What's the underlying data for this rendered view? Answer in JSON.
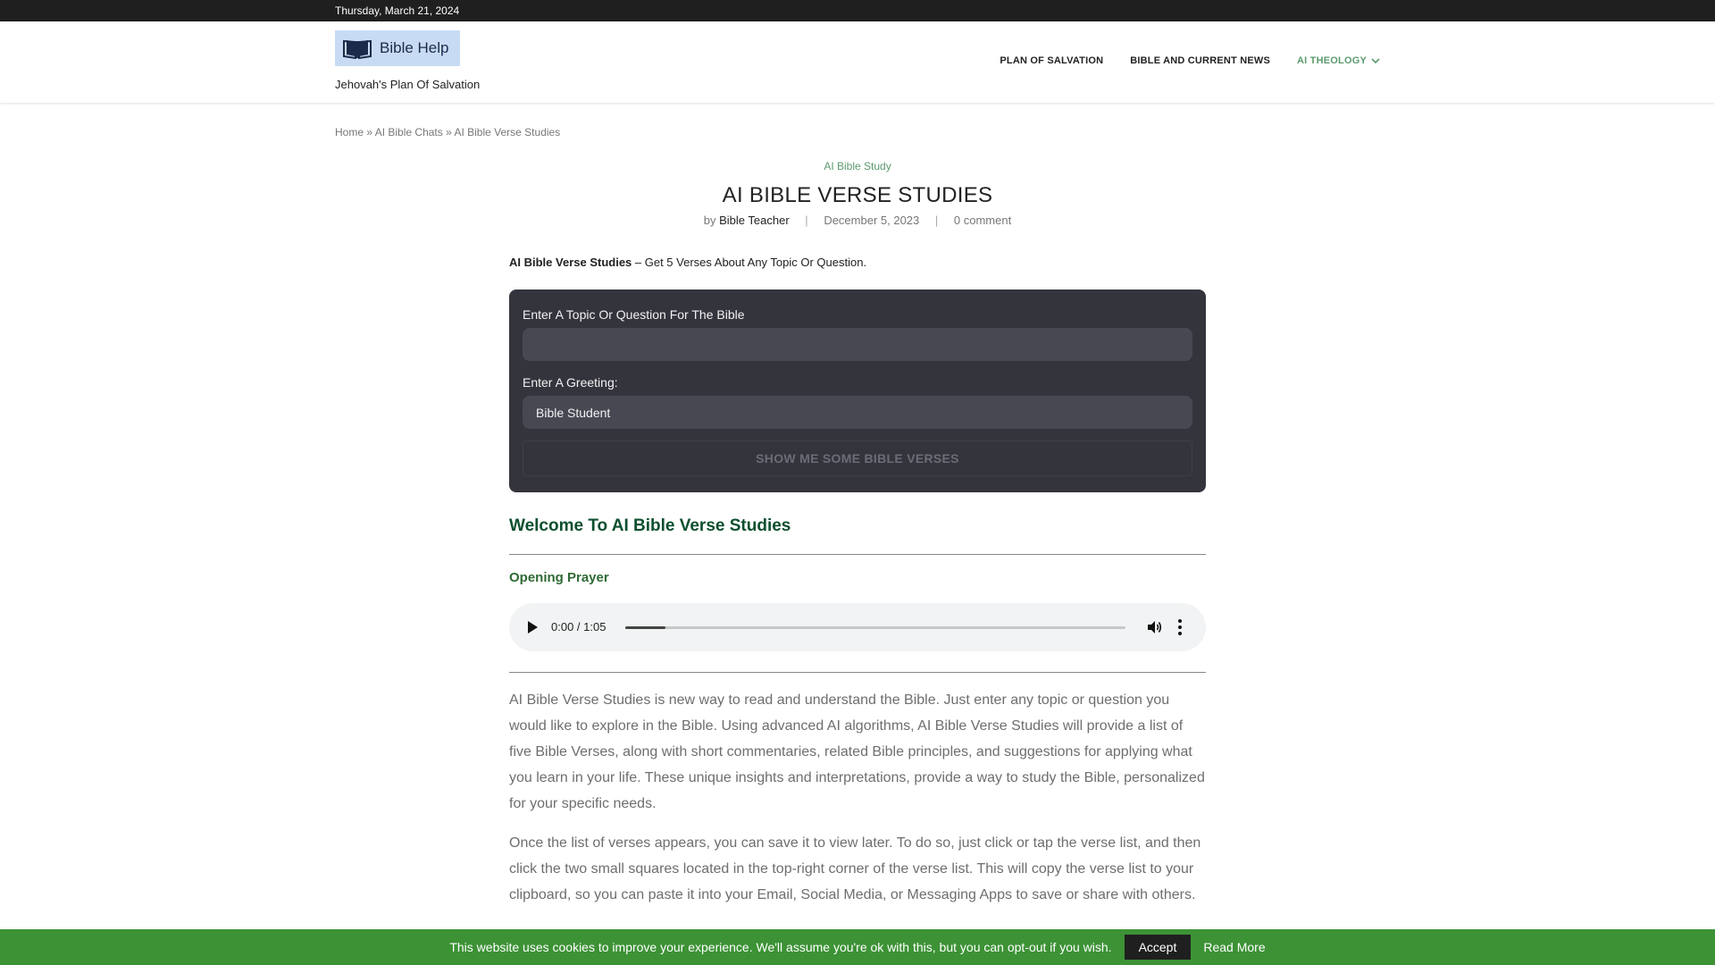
{
  "topbar": {
    "date": "Thursday, March 21, 2024"
  },
  "header": {
    "logo_text": "Bible Help",
    "tagline": "Jehovah's Plan Of Salvation",
    "nav": [
      {
        "label": "PLAN OF SALVATION"
      },
      {
        "label": "BIBLE AND CURRENT NEWS"
      },
      {
        "label": "AI THEOLOGY"
      }
    ]
  },
  "breadcrumb": {
    "home": "Home",
    "sep1": "»",
    "chats": "AI Bible Chats",
    "sep2": "»",
    "current": "AI Bible Verse Studies"
  },
  "post": {
    "category": "AI Bible Study",
    "title": "AI BIBLE VERSE STUDIES",
    "by": "by",
    "author": "Bible Teacher",
    "sep": "|",
    "date": "December 5, 2023",
    "comments": "0 comment",
    "intro_bold": "AI Bible Verse Studies",
    "intro_rest": " – Get 5 Verses About Any Topic Or Question."
  },
  "form": {
    "topic_label": "Enter A Topic Or Question For The Bible",
    "topic_value": "",
    "greeting_label": "Enter A Greeting:",
    "greeting_value": "Bible Student",
    "submit_label": "SHOW ME SOME BIBLE VERSES"
  },
  "welcome": "Welcome To AI Bible Verse Studies",
  "prayer": {
    "heading": "Opening Prayer",
    "time": "0:00 / 1:05",
    "progress": 0.08
  },
  "paragraphs": [
    "AI Bible Verse Studies is new way to read and understand the Bible. Just enter any topic or question you would like to explore in the Bible. Using advanced AI algorithms, AI Bible Verse Studies will provide a list of five Bible Verses, along with short commentaries, related Bible principles, and suggestions for applying what you learn in your life. These unique insights and interpretations, provide a way to study the Bible, personalized for your specific needs.",
    "Once the list of verses appears, you can save it to view later. To do so, just click or tap the verse list, and then click the two small squares located in the top-right corner of the verse list. This will copy the verse list to your clipboard, so you can paste it into your Email, Social Media, or Messaging Apps to save or share with others."
  ],
  "cookie": {
    "message": "This website uses cookies to improve your experience. We'll assume you're ok with this, but you can opt-out if you wish.",
    "accept": "Accept",
    "read_more": "Read More"
  },
  "colors": {
    "accent_green": "#5c9a6e",
    "dark_green": "#0d4f2e",
    "cookie_bar": "#3c9235",
    "form_bg": "#34343d"
  }
}
